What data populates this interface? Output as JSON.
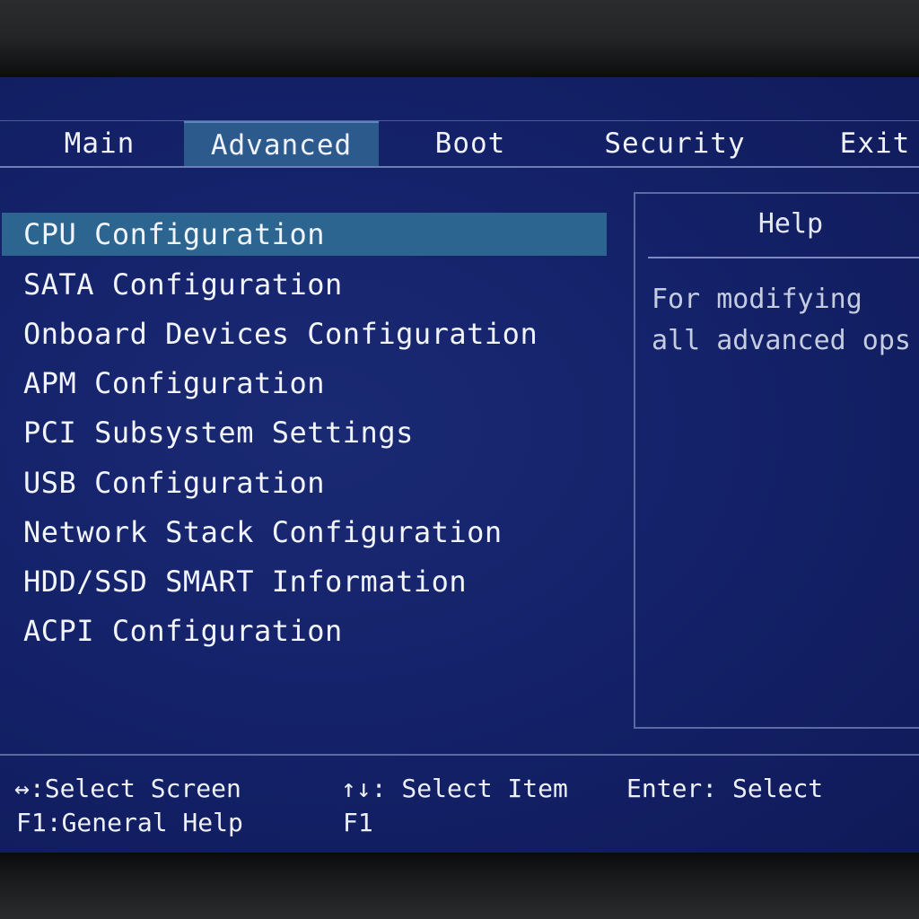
{
  "tabs": [
    {
      "label": "Main",
      "active": false
    },
    {
      "label": "Advanced",
      "active": true
    },
    {
      "label": "Boot",
      "active": false
    },
    {
      "label": "Security",
      "active": false
    },
    {
      "label": "Exit",
      "active": false
    }
  ],
  "menu": {
    "selected_index": 0,
    "items": [
      {
        "label": "CPU Configuration"
      },
      {
        "label": "SATA Configuration"
      },
      {
        "label": "Onboard Devices Configuration"
      },
      {
        "label": "APM Configuration"
      },
      {
        "label": "PCI Subsystem Settings"
      },
      {
        "label": "USB Configuration"
      },
      {
        "label": "Network Stack Configuration"
      },
      {
        "label": "HDD/SSD SMART Information"
      },
      {
        "label": "ACPI Configuration"
      }
    ]
  },
  "help": {
    "title": "Help",
    "lines": [
      "For modifying",
      "all advanced ops"
    ]
  },
  "footer": {
    "select_screen_keys": "↔",
    "select_screen_label": ":Select Screen",
    "select_item_keys": "↑↓",
    "select_item_label": ": Select Item",
    "enter_key": "Enter",
    "enter_label": ": Select",
    "f1_key": "F1",
    "f1_label": ":General Help",
    "f1_second": "F1"
  },
  "colors": {
    "screen_bg": "#14226a",
    "highlight": "#2c6690",
    "tab_active": "#2d5a8c",
    "text": "#f2f4fb"
  }
}
